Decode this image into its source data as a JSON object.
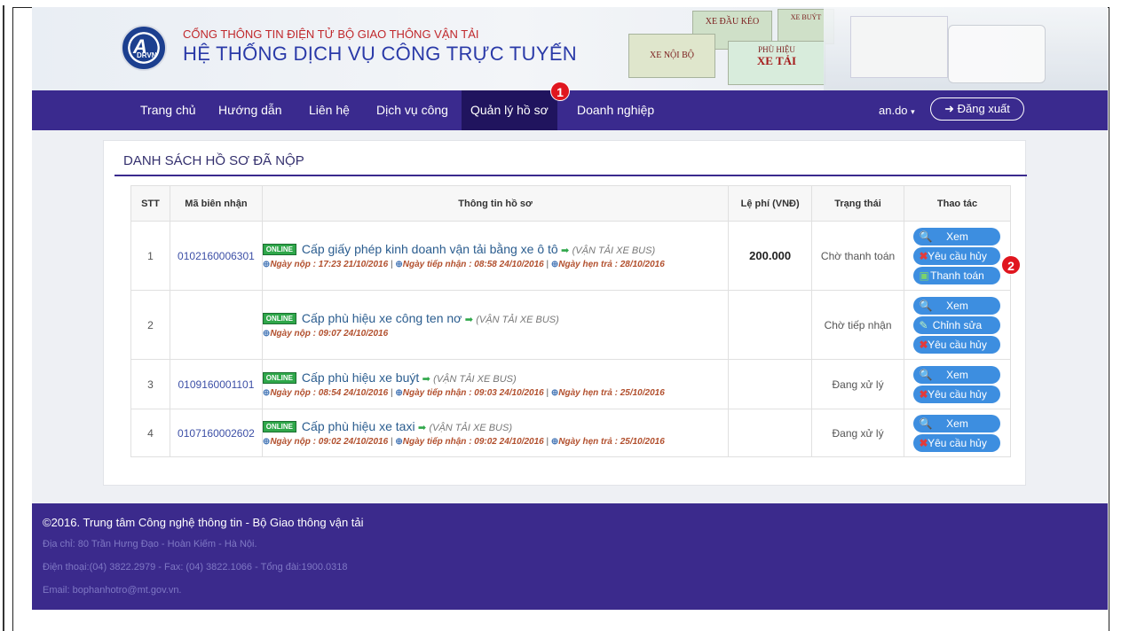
{
  "header": {
    "logo_text": "DRVN",
    "subtitle": "CỔNG THÔNG TIN ĐIỆN TỬ BỘ GIAO THÔNG VẬN TẢI",
    "title": "HỆ THỐNG DỊCH VỤ CÔNG TRỰC TUYẾN",
    "cards": [
      "XE ĐẦU KÉO",
      "XE BUÝT",
      "XE NỘI BỘ",
      "PHÙ HIỆU",
      "XE TẢI"
    ]
  },
  "nav": {
    "items": [
      "Trang chủ",
      "Hướng dẫn",
      "Liên hệ",
      "Dịch vụ công",
      "Quản lý hồ sơ",
      "Doanh nghiệp"
    ],
    "user": "an.do",
    "logout": "Đăng xuất"
  },
  "annotations": {
    "badge1": "1",
    "badge2": "2"
  },
  "panel": {
    "title": "DANH SÁCH HỒ SƠ ĐÃ NỘP",
    "columns": [
      "STT",
      "Mã biên nhận",
      "Thông tin hồ sơ",
      "Lệ phí (VNĐ)",
      "Trạng thái",
      "Thao tác"
    ],
    "online_label": "ONLINE",
    "rows": [
      {
        "stt": "1",
        "code": "0102160006301",
        "service": "Cấp giấy phép kinh doanh vận tải bằng xe ô tô",
        "type": "(VẬN TẢI XE BUS)",
        "d1": "Ngày nộp : 17:23 21/10/2016",
        "d2": "Ngày tiếp nhận : 08:58 24/10/2016",
        "d3": "Ngày hẹn trả : 28/10/2016",
        "fee": "200.000",
        "status": "Chờ thanh toán",
        "a1": "Xem",
        "a2": "Yêu cầu hủy",
        "a3": "Thanh toán"
      },
      {
        "stt": "2",
        "code": "",
        "service": "Cấp phù hiệu xe công ten nơ",
        "type": "(VẬN TẢI XE BUS)",
        "d1": "Ngày nộp : 09:07 24/10/2016",
        "fee": "",
        "status": "Chờ tiếp nhận",
        "a1": "Xem",
        "a2": "Chỉnh sửa",
        "a3": "Yêu cầu hủy"
      },
      {
        "stt": "3",
        "code": "0109160001101",
        "service": "Cấp phù hiệu xe buýt",
        "type": "(VẬN TẢI XE BUS)",
        "d1": "Ngày nộp : 08:54 24/10/2016",
        "d2": "Ngày tiếp nhận : 09:03 24/10/2016",
        "d3": "Ngày hẹn trả : 25/10/2016",
        "fee": "",
        "status": "Đang xử lý",
        "a1": "Xem",
        "a2": "Yêu cầu hủy"
      },
      {
        "stt": "4",
        "code": "0107160002602",
        "service": "Cấp phù hiệu xe taxi",
        "type": "(VẬN TẢI XE BUS)",
        "d1": "Ngày nộp : 09:02 24/10/2016",
        "d2": "Ngày tiếp nhận : 09:02 24/10/2016",
        "d3": "Ngày hẹn trả : 25/10/2016",
        "fee": "",
        "status": "Đang xử lý",
        "a1": "Xem",
        "a2": "Yêu cầu hủy"
      }
    ]
  },
  "footer": {
    "copyright": "©2016. Trung tâm Công nghệ thông tin - Bộ Giao thông vận tải",
    "address": "Địa chỉ: 80 Trần Hưng Đạo - Hoàn Kiếm - Hà Nội.",
    "phone": "Điện thoại:(04) 3822.2979 - Fax: (04) 3822.1066 - Tổng đài:1900.0318",
    "email": "Email: bophanhotro@mt.gov.vn."
  },
  "colors": {
    "nav": "#3a2a8e",
    "nav_active": "#20145e",
    "button": "#3d8ee0",
    "badge": "#e0161f"
  }
}
